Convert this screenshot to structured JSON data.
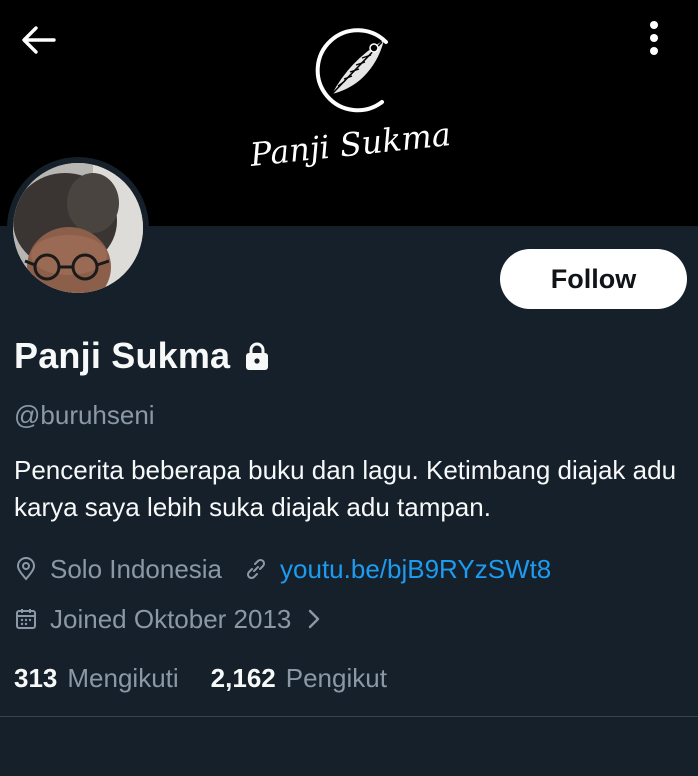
{
  "header": {
    "back_icon": "arrow-left-icon",
    "more_icon": "vertical-ellipsis-icon",
    "banner_logo_text": "Panji Sukma"
  },
  "profile": {
    "name": "Panji Sukma",
    "protected_icon": "lock-icon",
    "handle": "@buruhseni",
    "bio": "Pencerita beberapa buku dan lagu. Ketimbang diajak adu karya saya lebih suka diajak adu tampan.",
    "follow_label": "Follow",
    "location": "Solo Indonesia",
    "location_icon": "map-pin-icon",
    "website": "youtu.be/bjB9RYzSWt8",
    "website_icon": "link-icon",
    "joined": "Joined Oktober 2013",
    "joined_icon": "calendar-icon",
    "joined_chevron_icon": "chevron-right-icon"
  },
  "stats": {
    "following_count": "313",
    "following_label": "Mengikuti",
    "followers_count": "2,162",
    "followers_label": "Pengikut"
  },
  "colors": {
    "background": "#15202b",
    "banner": "#000000",
    "primary_text": "#f7f9f9",
    "secondary_text": "#8b98a5",
    "link": "#1d9bf0",
    "button_bg": "#ffffff",
    "divider": "#38444d"
  }
}
